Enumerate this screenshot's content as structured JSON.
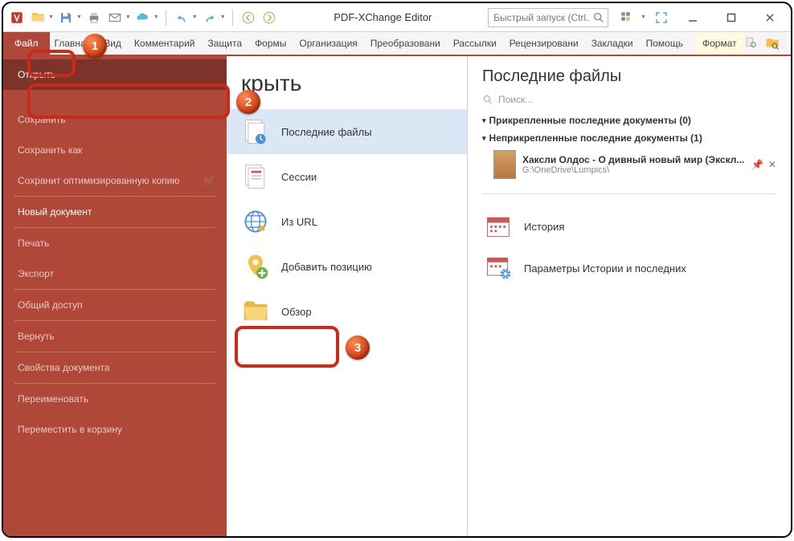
{
  "app": {
    "title": "PDF-XChange Editor"
  },
  "search": {
    "placeholder": "Быстрый запуск (Ctrl..."
  },
  "ribbon": {
    "file": "Файл",
    "tabs": [
      "Главная",
      "Вид",
      "Комментарий",
      "Защита",
      "Формы",
      "Организация",
      "Преобразовани",
      "Рассылки",
      "Рецензировани",
      "Закладки",
      "Помощь"
    ],
    "format": "Формат"
  },
  "filemenu": {
    "open": "Открыть",
    "save": "Сохранить",
    "saveas": "Сохранить как",
    "saveopt": "Сохранит оптимизированную копию",
    "newdoc": "Новый документ",
    "print": "Печать",
    "export": "Экспорт",
    "share": "Общий доступ",
    "revert": "Вернуть",
    "docprops": "Свойства документа",
    "rename": "Переименовать",
    "trash": "Переместить в корзину"
  },
  "center": {
    "title": "крыть",
    "recent": "Последние файлы",
    "sessions": "Сессии",
    "fromurl": "Из URL",
    "addplace": "Добавить позицию",
    "browse": "Обзор"
  },
  "right": {
    "title": "Последние файлы",
    "search": "Поиск...",
    "pinned": "Прикрепленные последние документы (0)",
    "unpinned": "Неприкрепленные последние документы (1)",
    "file1_title": "Хаксли Олдос - О дивный новый мир (Экскл...",
    "file1_path": "G:\\OneDrive\\Lumpics\\",
    "history": "История",
    "params": "Параметры Истории и последних"
  }
}
